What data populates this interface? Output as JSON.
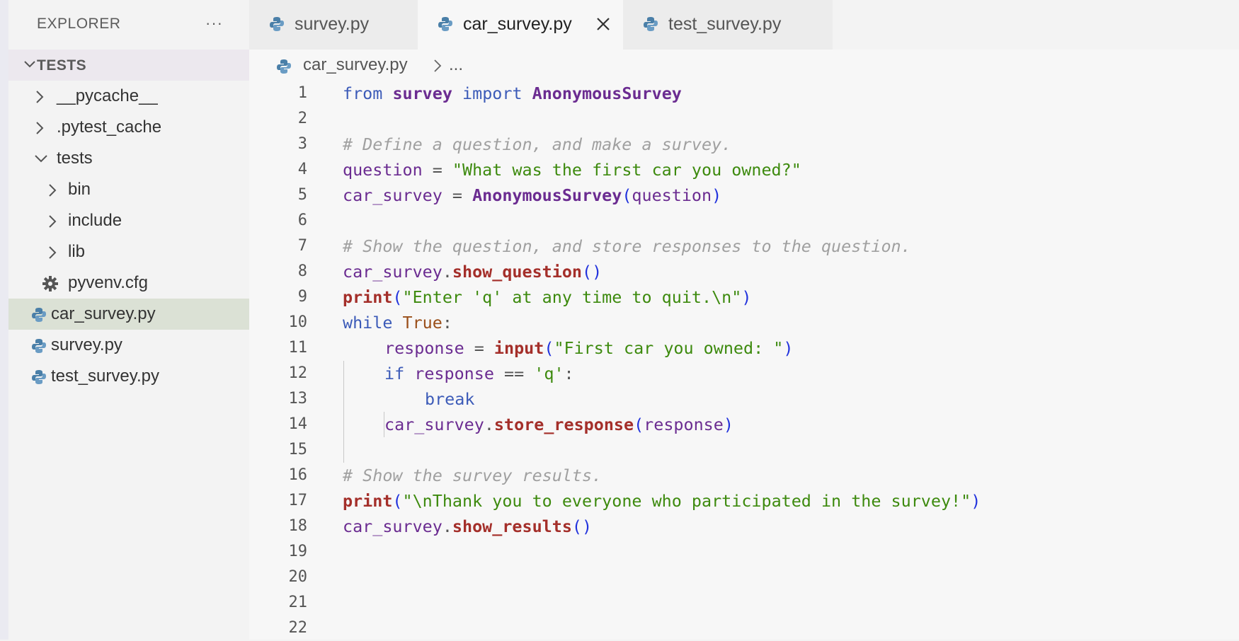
{
  "sidebar": {
    "title": "EXPLORER",
    "more": "···",
    "section": "TESTS",
    "tree": [
      {
        "label": "__pycache__",
        "kind": "folder",
        "expanded": false
      },
      {
        "label": ".pytest_cache",
        "kind": "folder",
        "expanded": false
      },
      {
        "label": "tests",
        "kind": "folder",
        "expanded": true
      },
      {
        "label": "bin",
        "kind": "folder",
        "expanded": false
      },
      {
        "label": "include",
        "kind": "folder",
        "expanded": false
      },
      {
        "label": "lib",
        "kind": "folder",
        "expanded": false
      },
      {
        "label": "pyvenv.cfg",
        "kind": "config-file"
      },
      {
        "label": "car_survey.py",
        "kind": "python-file",
        "selected": true
      },
      {
        "label": "survey.py",
        "kind": "python-file"
      },
      {
        "label": "test_survey.py",
        "kind": "python-file"
      }
    ]
  },
  "tabs": [
    {
      "label": "survey.py",
      "active": false
    },
    {
      "label": "car_survey.py",
      "active": true
    },
    {
      "label": "test_survey.py",
      "active": false
    }
  ],
  "breadcrumb": {
    "file": "car_survey.py",
    "more": "..."
  },
  "colors": {
    "keyword": "#3c5bb8",
    "string": "#3d8a0e",
    "comment": "#a0a0a0",
    "function": "#a42f2a",
    "class": "#6b2c91",
    "selection": "#dbe1d5",
    "python_icon": "#4a7fa8"
  },
  "code": {
    "line_numbers": [
      "1",
      "2",
      "3",
      "4",
      "5",
      "6",
      "7",
      "8",
      "9",
      "10",
      "11",
      "12",
      "13",
      "14",
      "15",
      "16",
      "17",
      "18",
      "19",
      "20",
      "21",
      "22"
    ],
    "t1a": "from",
    "t1b": "survey",
    "t1c": "import",
    "t1d": "AnonymousSurvey",
    "t3": "# Define a question, and make a survey.",
    "t4a": "question",
    "t4b": " = ",
    "t4c": "\"What was the first car you owned?\"",
    "t5a": "car_survey",
    "t5b": " = ",
    "t5c": "AnonymousSurvey",
    "t5d": "(",
    "t5e": "question",
    "t5f": ")",
    "t7": "# Show the question, and store responses to the question.",
    "t8a": "car_survey",
    "t8b": ".",
    "t8c": "show_question",
    "t8d": "()",
    "t9a": "print",
    "t9b": "(",
    "t9c": "\"Enter 'q' at any time to quit.\\n\"",
    "t9d": ")",
    "t10a": "while",
    "t10b": " ",
    "t10c": "True",
    "t10d": ":",
    "t11a": "response",
    "t11b": " = ",
    "t11c": "input",
    "t11d": "(",
    "t11e": "\"First car you owned: \"",
    "t11f": ")",
    "t12a": "if",
    "t12b": " ",
    "t12c": "response",
    "t12d": " == ",
    "t12e": "'q'",
    "t12f": ":",
    "t13": "break",
    "t14a": "car_survey",
    "t14b": ".",
    "t14c": "store_response",
    "t14d": "(",
    "t14e": "response",
    "t14f": ")",
    "t16": "# Show the survey results.",
    "t17a": "print",
    "t17b": "(",
    "t17c": "\"\\nThank you to everyone who participated in the survey!\"",
    "t17d": ")",
    "t18a": "car_survey",
    "t18b": ".",
    "t18c": "show_results",
    "t18d": "()"
  }
}
